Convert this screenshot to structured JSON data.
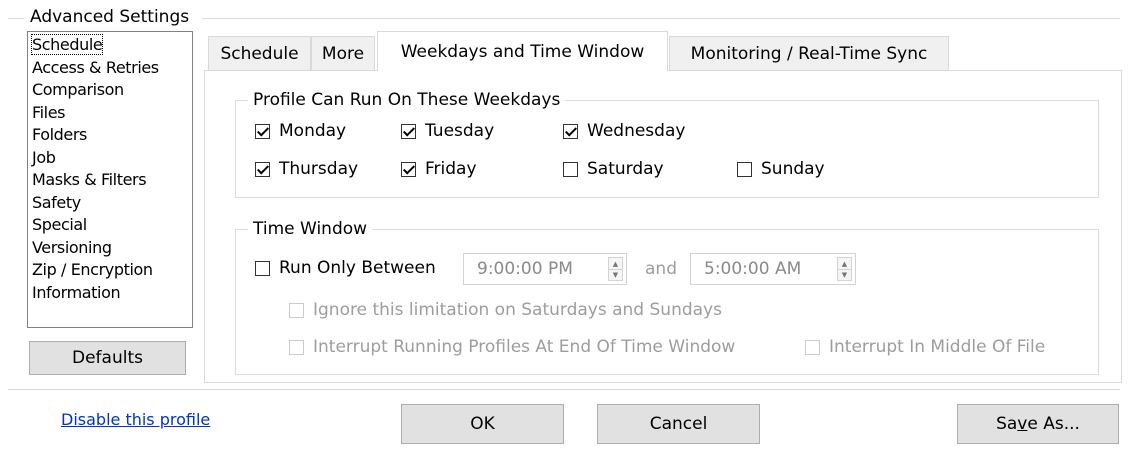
{
  "advanced_settings": {
    "title": "Advanced Settings",
    "items": [
      {
        "label": "Schedule",
        "selected": true
      },
      {
        "label": "Access & Retries"
      },
      {
        "label": "Comparison"
      },
      {
        "label": "Files"
      },
      {
        "label": "Folders"
      },
      {
        "label": "Job"
      },
      {
        "label": "Masks & Filters"
      },
      {
        "label": "Safety"
      },
      {
        "label": "Special"
      },
      {
        "label": "Versioning"
      },
      {
        "label": "Zip / Encryption"
      },
      {
        "label": "Information"
      }
    ],
    "defaults_label": "Defaults"
  },
  "tabs": [
    {
      "label": "Schedule"
    },
    {
      "label": "More"
    },
    {
      "label": "Weekdays and Time Window",
      "active": true
    },
    {
      "label": "Monitoring / Real-Time Sync"
    }
  ],
  "weekdays": {
    "title": "Profile Can Run On These Weekdays",
    "days": [
      {
        "label": "Monday",
        "checked": true
      },
      {
        "label": "Tuesday",
        "checked": true
      },
      {
        "label": "Wednesday",
        "checked": true
      },
      {
        "label": "Thursday",
        "checked": true
      },
      {
        "label": "Friday",
        "checked": true
      },
      {
        "label": "Saturday",
        "checked": false
      },
      {
        "label": "Sunday",
        "checked": false
      }
    ]
  },
  "time_window": {
    "title": "Time Window",
    "run_only_between_label": "Run Only Between",
    "run_only_between_checked": false,
    "start_time": "9:00:00 PM",
    "and_label": "and",
    "end_time": "5:00:00 AM",
    "ignore_weekends_label": "Ignore this limitation on Saturdays and Sundays",
    "interrupt_end_label": "Interrupt Running Profiles At End Of Time Window",
    "interrupt_middle_label": "Interrupt In Middle Of File"
  },
  "footer": {
    "disable_link": "Disable this profile",
    "ok_label": "OK",
    "cancel_label": "Cancel",
    "save_as_pre": "Sa",
    "save_as_mnemonic": "v",
    "save_as_post": "e As..."
  },
  "colors": {
    "link": "#0033cc",
    "button_face": "#e1e1e1",
    "disabled_text": "#9d9d9d"
  }
}
